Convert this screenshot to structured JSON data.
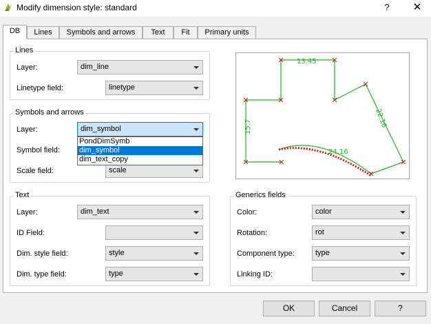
{
  "window": {
    "title": "Modify dimension style: standard",
    "help_glyph": "?",
    "close_glyph": "✕"
  },
  "tabs": [
    {
      "label": "DB",
      "active": true
    },
    {
      "label": "Lines"
    },
    {
      "label": "Symbols and arrows"
    },
    {
      "label": "Text"
    },
    {
      "label": "Fit"
    },
    {
      "label": "Primary units"
    }
  ],
  "lines_group": {
    "title": "Lines",
    "layer_label": "Layer:",
    "layer_value": "dim_line",
    "linetype_label": "Linetype field:",
    "linetype_value": "linetype"
  },
  "symbols_group": {
    "title": "Symbols and arrows",
    "layer_label": "Layer:",
    "layer_value": "dim_symbol",
    "symbol_label": "Symbol field:",
    "scale_label": "Scale field:",
    "scale_value": "scale",
    "dropdown_options": [
      "PondDimSymb",
      "dim_symbol",
      "dim_text_copy"
    ],
    "dropdown_selected": "dim_symbol"
  },
  "text_group": {
    "title": "Text",
    "layer_label": "Layer:",
    "layer_value": "dim_text",
    "id_label": "ID Field:",
    "id_value": "",
    "style_label": "Dim. style field:",
    "style_value": "style",
    "type_label": "Dim. type field:",
    "type_value": "type"
  },
  "generics_group": {
    "title": "Generics fields",
    "color_label": "Color:",
    "color_value": "color",
    "rotation_label": "Rotation:",
    "rotation_value": "rot",
    "component_label": "Component type:",
    "component_value": "type",
    "linking_label": "Linking ID:",
    "linking_value": ""
  },
  "preview": {
    "dim_labels": [
      "13.45",
      "15.7",
      "22.16",
      "24.16"
    ],
    "line_color": "#1fb31f",
    "marker_color": "#c01818"
  },
  "buttons": {
    "ok": "OK",
    "cancel": "Cancel",
    "help": "?"
  }
}
